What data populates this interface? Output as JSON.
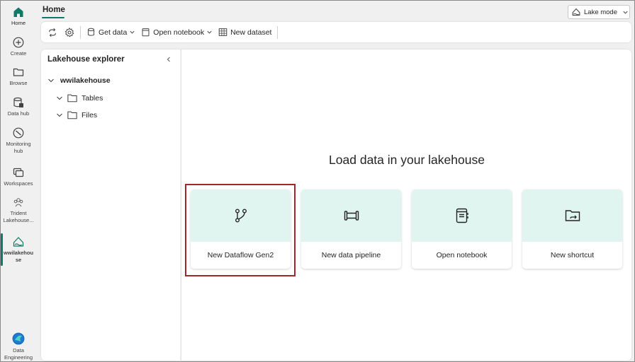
{
  "rail": {
    "items": [
      {
        "label": "Home",
        "icon": "home-icon"
      },
      {
        "label": "Create",
        "icon": "plus-circle-icon"
      },
      {
        "label": "Browse",
        "icon": "folder-icon"
      },
      {
        "label": "Data hub",
        "icon": "database-icon"
      },
      {
        "label": "Monitoring hub",
        "icon": "monitoring-icon"
      },
      {
        "label": "Workspaces",
        "icon": "workspaces-icon"
      },
      {
        "label": "Trident Lakehouse...",
        "icon": "group-icon"
      },
      {
        "label": "wwilakehouse",
        "icon": "lakehouse-icon"
      },
      {
        "label": "Data Engineering",
        "icon": "data-engineering-logo"
      }
    ]
  },
  "topbar": {
    "home_tab": "Home",
    "lake_mode": "Lake mode"
  },
  "toolbar": {
    "get_data": "Get data",
    "open_notebook": "Open notebook",
    "new_dataset": "New dataset"
  },
  "explorer": {
    "title": "Lakehouse explorer",
    "root": "wwilakehouse",
    "children": [
      "Tables",
      "Files"
    ]
  },
  "main": {
    "heading": "Load data in your lakehouse",
    "cards": [
      {
        "label": "New Dataflow Gen2",
        "icon": "dataflow-icon",
        "highlighted": true
      },
      {
        "label": "New data pipeline",
        "icon": "pipeline-icon"
      },
      {
        "label": "Open notebook",
        "icon": "notebook-icon"
      },
      {
        "label": "New shortcut",
        "icon": "shortcut-folder-icon"
      }
    ]
  },
  "colors": {
    "accent": "#117865",
    "card_top": "#e0f5ef",
    "highlight": "#a4262c"
  }
}
